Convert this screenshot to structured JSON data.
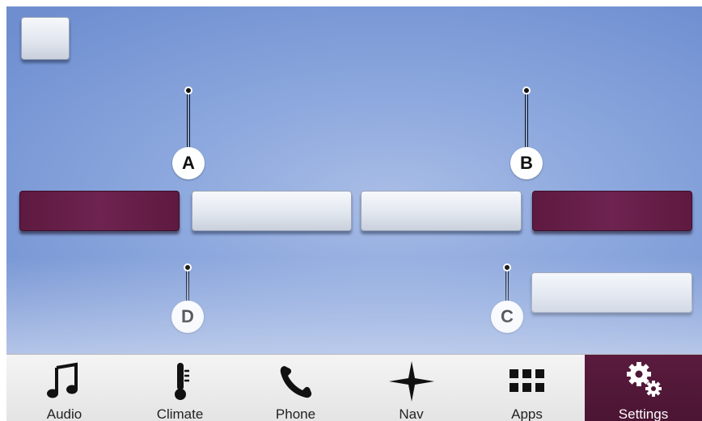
{
  "callouts": [
    {
      "letter": "A"
    },
    {
      "letter": "B"
    },
    {
      "letter": "C"
    },
    {
      "letter": "D"
    }
  ],
  "navbar": {
    "items": [
      {
        "label": "Audio",
        "icon": "music-note-icon",
        "active": false
      },
      {
        "label": "Climate",
        "icon": "thermometer-icon",
        "active": false
      },
      {
        "label": "Phone",
        "icon": "phone-icon",
        "active": false
      },
      {
        "label": "Nav",
        "icon": "compass-star-icon",
        "active": false
      },
      {
        "label": "Apps",
        "icon": "grid-icon",
        "active": false
      },
      {
        "label": "Settings",
        "icon": "gears-icon",
        "active": true
      }
    ]
  },
  "colors": {
    "accent_maroon": "#6e2350",
    "background_blue": "#8ea9de",
    "navbar_gray": "#e8e8e8"
  }
}
